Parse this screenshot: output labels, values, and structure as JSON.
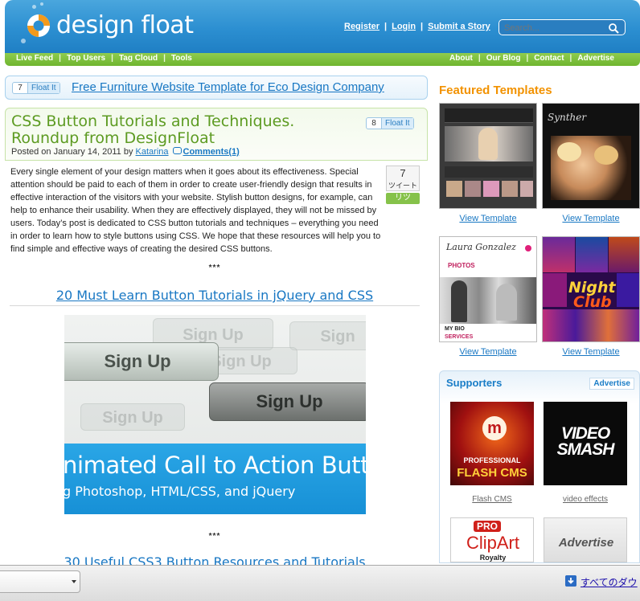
{
  "site": {
    "name": "design float"
  },
  "header": {
    "links": [
      "Register",
      "Login",
      "Submit a Story"
    ],
    "search_placeholder": "Search..."
  },
  "nav": {
    "left": [
      "Live Feed",
      "Top Users",
      "Tag Cloud",
      "Tools"
    ],
    "right": [
      "About",
      "Our Blog",
      "Contact",
      "Advertise"
    ]
  },
  "float_bar": {
    "count": "7",
    "float_label": "Float It",
    "link": "Free Furniture Website Template for Eco Design Company"
  },
  "article": {
    "title": "CSS Button Tutorials and Techniques. Roundup from DesignFloat",
    "float_count": "8",
    "float_label": "Float It",
    "posted_prefix": "Posted on January 14, 2011 by",
    "author": "Katarina",
    "comments": "Comments(1)",
    "body": "Every single element of your design matters when it goes about its effectiveness. Special attention should be paid to each of them in order to create user-friendly design that results in effective interaction of the visitors with your website. Stylish button designs, for example, can help to enhance their usability. When they are effectively displayed, they will not be missed by users. Today’s post is dedicated to CSS button tutorials and techniques – everything you need in order to learn how to style buttons using CSS. We hope that these resources will help you to find simple and effective ways of creating the desired CSS buttons.",
    "separator": "***",
    "section_1_title": "20 Must Learn Button Tutorials in jQuery and CSS",
    "section_2_title": "30 Useful CSS3 Button Resources and Tutorials",
    "image": {
      "buttons": [
        "Sign Up",
        "Sign Up"
      ],
      "ghost_text": [
        "Sign Up",
        "Sign Up",
        "Sign Up",
        "Sign"
      ],
      "banner_title": "nimated Call to Action Butto",
      "banner_subtitle": "g Photoshop, HTML/CSS, and jQuery"
    }
  },
  "tweet": {
    "count": "7",
    "label": "ツイート",
    "retweet": "リツ"
  },
  "sidebar": {
    "featured_heading": "Featured Templates",
    "view_label": "View Template",
    "thumb_text": {
      "t2_brand": "Synther",
      "t3_brand": "Laura Gonzalez",
      "t3_photos": "PHOTOS",
      "t3_bio": "MY BIO",
      "t3_services": "SERVICES",
      "t4_sign_1": "Night",
      "t4_sign_2": "Club"
    },
    "supporters_heading": "Supporters",
    "advertise_button": "Advertise",
    "ads": [
      {
        "name": "Flash CMS",
        "line1": "PROFESSIONAL",
        "line2": "FLASH CMS"
      },
      {
        "name": "video effects",
        "line1": "VIDEO",
        "line2": "SMASH"
      },
      {
        "name": "",
        "line1": "PRO",
        "line2": "ClipArt",
        "line3": "Royalty"
      },
      {
        "name": "",
        "line1": "Advertise"
      }
    ]
  },
  "download_bar": {
    "all_downloads": "すべてのダウ"
  },
  "colors": {
    "header_blue": "#2c8fd1",
    "nav_green": "#7dbf3c",
    "title_green": "#5d9b22",
    "link_blue": "#1877c3",
    "featured_orange": "#f29200"
  }
}
